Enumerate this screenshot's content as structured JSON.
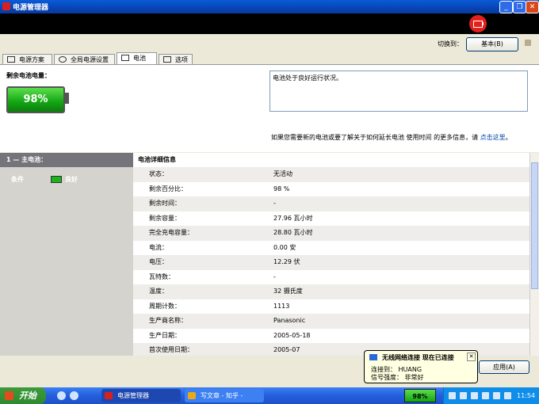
{
  "window": {
    "title": "电源管理器"
  },
  "toolbar": {
    "switch_label": "切换到：",
    "basic_button": "基本(B)"
  },
  "tabs": [
    {
      "label": "电源方案"
    },
    {
      "label": "全局电源设置"
    },
    {
      "label": "电池",
      "active": true
    },
    {
      "label": "选项"
    }
  ],
  "battery": {
    "remaining_label": "剩余电池电量：",
    "percent": "98%",
    "status_text": "电池处于良好运行状况。",
    "info_text": "如果您需要新的电池或要了解关于如何延长电池 使用时间 的更多信息，请",
    "info_link": "点击这里",
    "info_end": "。"
  },
  "left_pane": {
    "header": "1 — 主电池：",
    "condition_label": "条件",
    "condition_value": "良好"
  },
  "details": {
    "header": "电池详细信息",
    "rows": [
      {
        "key": "状态：",
        "value": "无活动"
      },
      {
        "key": "剩余百分比：",
        "value": "98 %"
      },
      {
        "key": "剩余时间：",
        "value": "-"
      },
      {
        "key": "剩余容量：",
        "value": "27.96 瓦小时"
      },
      {
        "key": "完全充电容量：",
        "value": "28.80 瓦小时"
      },
      {
        "key": "电流：",
        "value": "0.00 安"
      },
      {
        "key": "电压：",
        "value": "12.29 伏"
      },
      {
        "key": "瓦特数：",
        "value": "-"
      },
      {
        "key": "温度：",
        "value": "32 摄氏度"
      },
      {
        "key": "周期计数：",
        "value": "1113"
      },
      {
        "key": "生产商名称：",
        "value": "Panasonic"
      },
      {
        "key": "生产日期：",
        "value": "2005-05-18"
      },
      {
        "key": "首次使用日期：",
        "value": "2005-07"
      }
    ]
  },
  "buttons": {
    "apply": "应用(A)"
  },
  "balloon": {
    "title": "无线网络连接 现在已连接",
    "line1": "连接到： HUANG",
    "line2": "信号强度： 非常好"
  },
  "taskbar": {
    "start": "开始",
    "tasks": [
      {
        "label": "电源管理器",
        "icon_color": "#d9201e"
      },
      {
        "label": "写文章 - 知乎 -",
        "icon_color": "#e8a91c"
      }
    ],
    "tray_battery": "98%",
    "clock": "11:54"
  },
  "colors": {
    "accent": "#0a5bd8",
    "battery_green": "#13a513",
    "link": "#0645ad"
  }
}
